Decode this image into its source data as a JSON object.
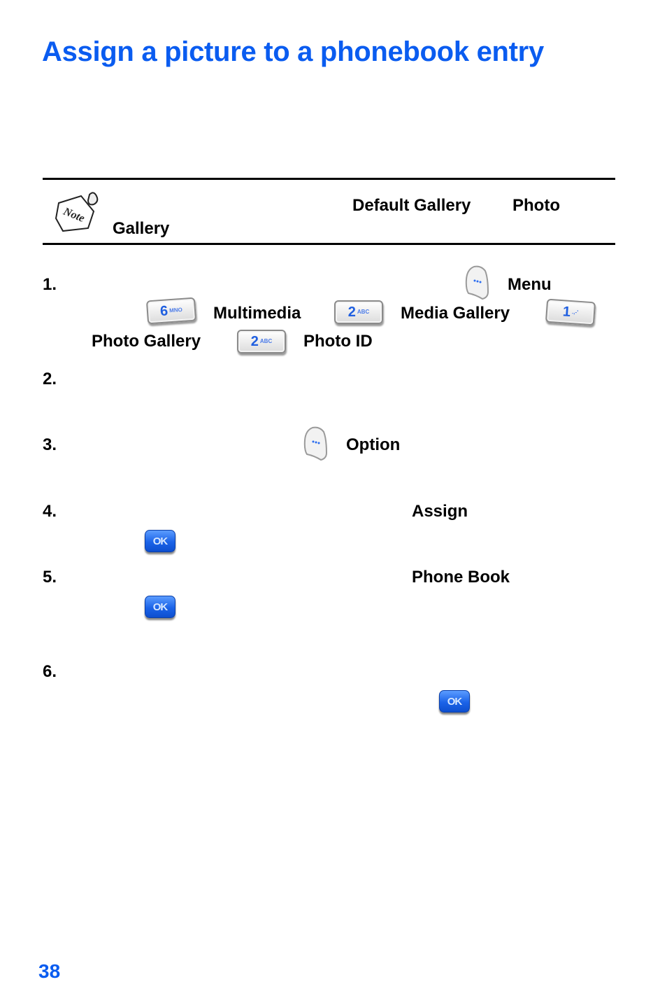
{
  "title": "Assign a picture to a phonebook entry",
  "note": {
    "icon": "note-icon",
    "icon_text": "Note",
    "bold_terms": [
      "Default Gallery",
      "Photo",
      "Gallery"
    ]
  },
  "steps": [
    {
      "number": "1.",
      "items": [
        {
          "type": "softkey",
          "icon": "left-soft-key-icon"
        },
        {
          "type": "label",
          "text": "Menu"
        },
        {
          "type": "key",
          "digit": "6",
          "sub": "MNO",
          "icon": "key-6-icon"
        },
        {
          "type": "label",
          "text": "Multimedia"
        },
        {
          "type": "key",
          "digit": "2",
          "sub": "ABC",
          "icon": "key-2-icon"
        },
        {
          "type": "label",
          "text": "Media Gallery"
        },
        {
          "type": "key",
          "digit": "1",
          "sub": ".,-'",
          "icon": "key-1-icon"
        },
        {
          "type": "label",
          "text": "Photo Gallery"
        },
        {
          "type": "key",
          "digit": "2",
          "sub": "ABC",
          "icon": "key-2-icon"
        },
        {
          "type": "label",
          "text": "Photo ID"
        }
      ]
    },
    {
      "number": "2.",
      "items": []
    },
    {
      "number": "3.",
      "items": [
        {
          "type": "softkey",
          "icon": "left-soft-key-icon"
        },
        {
          "type": "label",
          "text": "Option"
        }
      ]
    },
    {
      "number": "4.",
      "items": [
        {
          "type": "label",
          "text": "Assign"
        },
        {
          "type": "ok",
          "text": "OK",
          "icon": "ok-key-icon"
        }
      ]
    },
    {
      "number": "5.",
      "items": [
        {
          "type": "label",
          "text": "Phone Book"
        },
        {
          "type": "ok",
          "text": "OK",
          "icon": "ok-key-icon"
        }
      ]
    },
    {
      "number": "6.",
      "items": [
        {
          "type": "ok",
          "text": "OK",
          "icon": "ok-key-icon"
        }
      ]
    }
  ],
  "page_number": "38",
  "colors": {
    "heading": "#0a5cf0",
    "key_digit": "#1f5fe0",
    "ok_key": "#1b63e8"
  }
}
